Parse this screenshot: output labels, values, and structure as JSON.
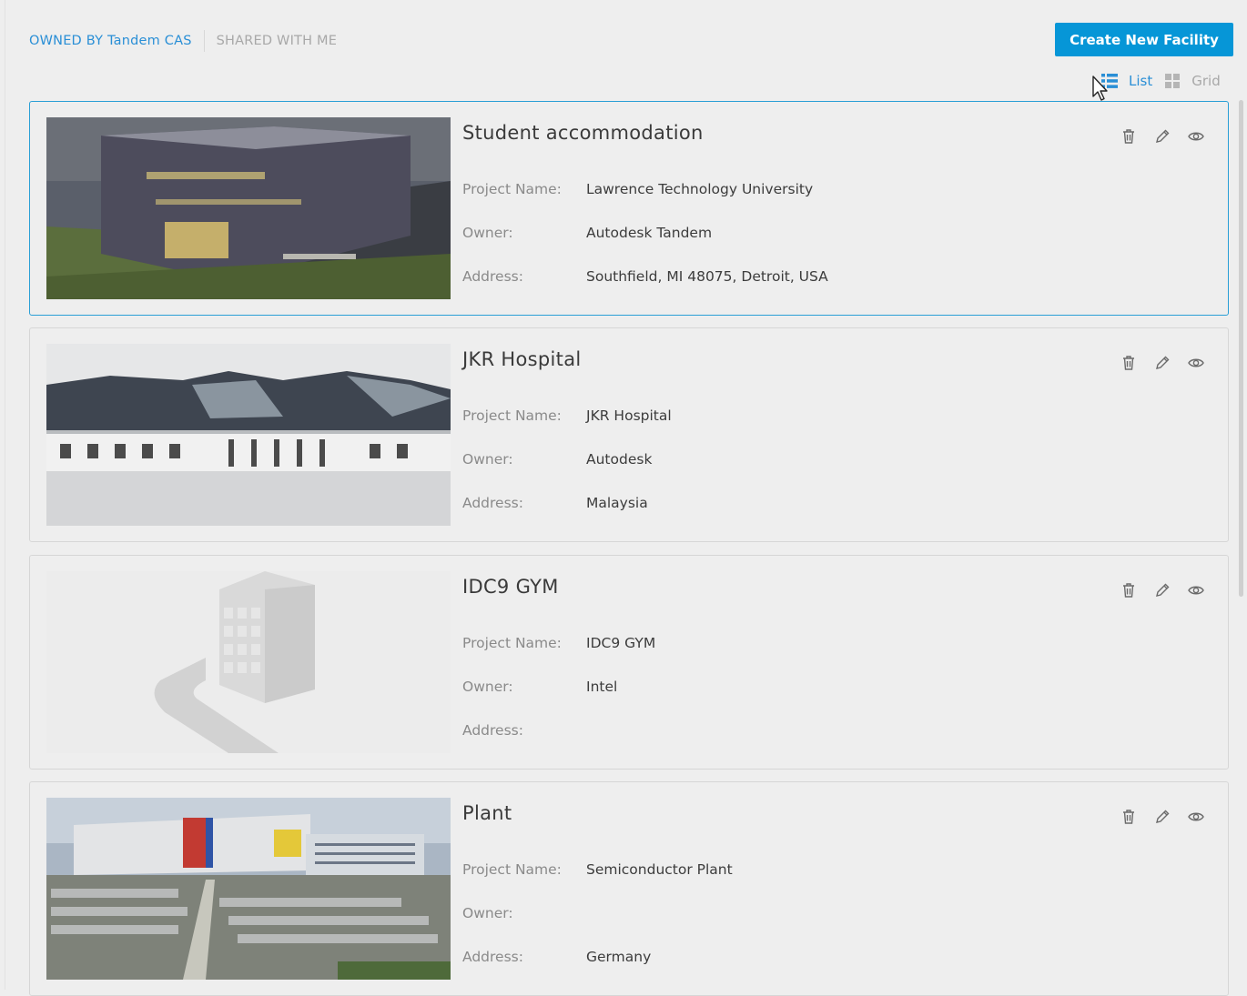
{
  "tabs": {
    "owned": "OWNED BY Tandem CAS",
    "shared": "SHARED WITH ME"
  },
  "toolbar": {
    "create_label": "Create New Facility",
    "list_label": "List",
    "grid_label": "Grid"
  },
  "labels": {
    "project_name": "Project Name:",
    "owner": "Owner:",
    "address": "Address:"
  },
  "facilities": [
    {
      "title": "Student accommodation",
      "project_name": "Lawrence Technology University",
      "owner": "Autodesk Tandem",
      "address": "Southfield, MI 48075, Detroit, USA"
    },
    {
      "title": "JKR Hospital",
      "project_name": "JKR Hospital",
      "owner": "Autodesk",
      "address": "Malaysia"
    },
    {
      "title": "IDC9 GYM",
      "project_name": "IDC9 GYM",
      "owner": "Intel",
      "address": ""
    },
    {
      "title": "Plant",
      "project_name": "Semiconductor Plant",
      "owner": "",
      "address": "Germany"
    }
  ],
  "colors": {
    "accent": "#0696d7",
    "link": "#2a8fd6",
    "selected_border": "#2a9fd6"
  },
  "icons": [
    "list-view-icon",
    "grid-view-icon",
    "delete-icon",
    "edit-pencil-icon",
    "view-eye-icon",
    "mouse-cursor-icon"
  ]
}
